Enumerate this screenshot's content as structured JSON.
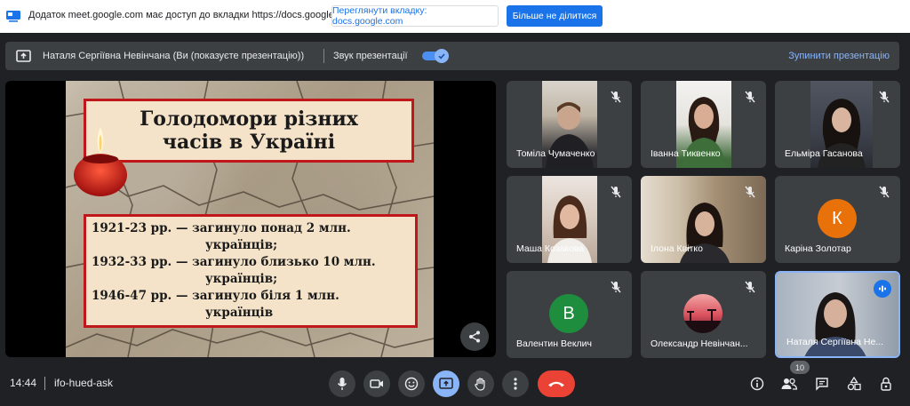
{
  "sharebar": {
    "message": "Додаток meet.google.com має доступ до вкладки https://docs.google.com",
    "view_tab_label": "Переглянути вкладку: docs.google.com",
    "stop_sharing_label": "Більше не ділитися"
  },
  "presenter": {
    "presenter_label": "Наталя Сергіївна Невінчана (Ви (показуєте презентацію))",
    "sound_label": "Звук презентації",
    "sound_on": true,
    "stop_label": "Зупинити презентацію"
  },
  "slide": {
    "title_line1": "Голодомори  різних",
    "title_line2": "часів в Україні",
    "fact1_a": "1921-23 рр. — загинуло понад 2 млн.",
    "fact1_b": "українців;",
    "fact2_a": "1932-33 рр. — загинуло близько 10 млн.",
    "fact2_b": "українців;",
    "fact3_a": "1946-47 рр. — загинуло біля 1 млн.",
    "fact3_b": "українців"
  },
  "participants": [
    {
      "name": "Томіла Чумаченко",
      "muted": true
    },
    {
      "name": "Іванна Тиквенко",
      "muted": true
    },
    {
      "name": "Ельміра Гасанова",
      "muted": true
    },
    {
      "name": "Маша Козакова",
      "muted": true
    },
    {
      "name": "Ілона Квітко",
      "muted": true
    },
    {
      "name": "Каріна Золотар",
      "muted": true,
      "initial": "К",
      "color": "#e8710a"
    },
    {
      "name": "Валентин Веклич",
      "muted": true,
      "initial": "В",
      "color": "#1e8e3e"
    },
    {
      "name": "Олександр Невінчан...",
      "muted": true
    },
    {
      "name": "Наталя Сергіївна Не...",
      "speaking": true
    }
  ],
  "bottombar": {
    "time": "14:44",
    "meeting_code": "ifo-hued-ask",
    "participant_count": "10"
  },
  "colors": {
    "accent": "#1a73e8",
    "hangup": "#ea4335",
    "link": "#8ab4f8"
  }
}
